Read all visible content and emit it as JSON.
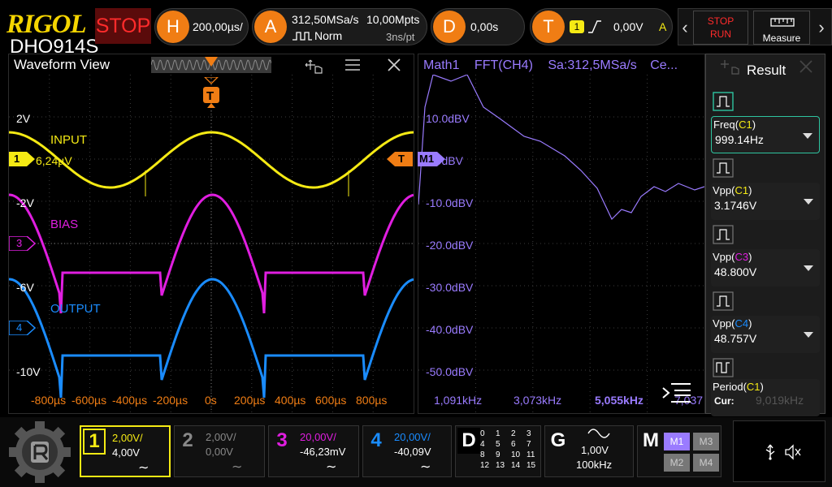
{
  "brand": {
    "logo": "RIGOL",
    "model": "DHO914S"
  },
  "run_state": {
    "label": "STOP"
  },
  "horizontal": {
    "badge": "H",
    "timebase": "200,00µs/"
  },
  "acquire": {
    "badge": "A",
    "sample_rate": "312,50MSa/s",
    "mode": "Norm",
    "depth": "10,00Mpts",
    "resolution": "3ns/pt"
  },
  "delay": {
    "badge": "D",
    "value": "0,00s"
  },
  "trigger": {
    "badge": "T",
    "source": "1",
    "level": "0,00V",
    "coupling": "A"
  },
  "toolbar": {
    "stop_run_top": "STOP",
    "stop_run_bottom": "RUN",
    "measure_label": "Measure"
  },
  "waveform_view": {
    "title": "Waveform View",
    "trigger_marker": "T",
    "volt_labels": [
      "2V",
      "-2V",
      "-6V",
      "-10V"
    ],
    "time_labels": [
      "-800µs",
      "-600µs",
      "-400µs",
      "-200µs",
      "0s",
      "200µs",
      "400µs",
      "600µs",
      "800µs"
    ],
    "ch1_marker": "1",
    "ch1_offset": "6,24µV",
    "ch3_marker": "3",
    "ch4_marker": "4",
    "labels": {
      "input": "INPUT",
      "bias": "BIAS",
      "output": "OUTPUT"
    }
  },
  "fft_view": {
    "source": "Math1",
    "func": "FFT(CH4)",
    "sample_rate": "Sa:312,5MSa/s",
    "center": "Ce...",
    "marker": "M1",
    "db_labels": [
      "10.0dBV",
      "0.0dBV",
      "-10.0dBV",
      "-20.0dBV",
      "-30.0dBV",
      "-40.0dBV",
      "-50.0dBV"
    ],
    "freq_labels": [
      "1,091kHz",
      "3,073kHz",
      "5,055kHz",
      "7,037",
      "9,019kHz"
    ]
  },
  "result": {
    "title": "Result",
    "items": [
      {
        "name": "Freq",
        "src": "C1",
        "value": "999.14Hz"
      },
      {
        "name": "Vpp",
        "src": "C1",
        "value": "3.1746V"
      },
      {
        "name": "Vpp",
        "src": "C3",
        "value": "48.800V"
      },
      {
        "name": "Vpp",
        "src": "C4",
        "value": "48.757V"
      },
      {
        "name": "Period",
        "src": "C1",
        "value": "Cur:"
      }
    ]
  },
  "channels": [
    {
      "num": "1",
      "scale": "2,00V/",
      "offset": "4,00V",
      "color": "#f5ea14"
    },
    {
      "num": "2",
      "scale": "2,00V/",
      "offset": "0,00V",
      "color": "#888888"
    },
    {
      "num": "3",
      "scale": "20,00V/",
      "offset": "-46,23mV",
      "color": "#e01ee0"
    },
    {
      "num": "4",
      "scale": "20,00V/",
      "offset": "-40,09V",
      "color": "#1a8cff"
    }
  ],
  "digital": {
    "label": "D",
    "bits": [
      "0",
      "1",
      "2",
      "3",
      "4",
      "5",
      "6",
      "7",
      "8",
      "9",
      "10",
      "11",
      "12",
      "13",
      "14",
      "15"
    ]
  },
  "generator": {
    "label": "G",
    "amplitude": "1,00V",
    "frequency": "100kHz"
  },
  "math_refs": {
    "label": "M",
    "items": [
      "M1",
      "M3",
      "M2",
      "M4"
    ]
  },
  "colors": {
    "ch1": "#f5ea14",
    "ch3": "#e01ee0",
    "ch4": "#1a8cff",
    "math": "#9a7bff",
    "trigger": "#f07d14",
    "grid": "#5a5a5a"
  }
}
